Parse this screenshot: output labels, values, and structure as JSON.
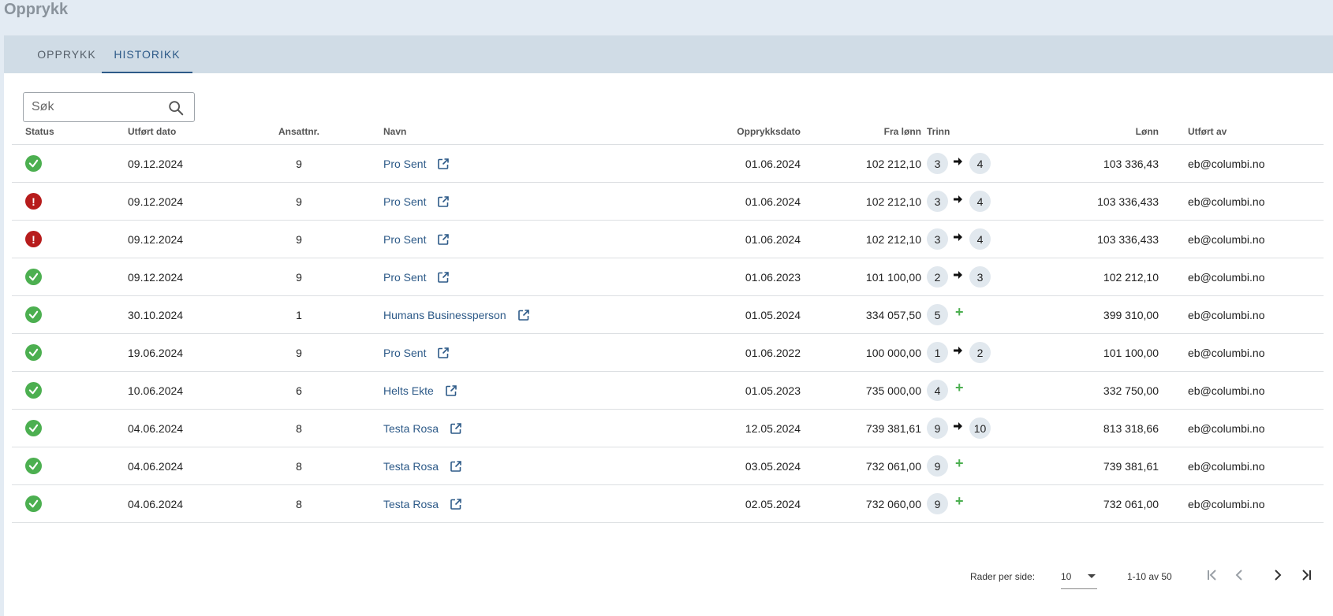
{
  "page": {
    "title": "Opprykk"
  },
  "tabs": [
    {
      "label": "OPPRYKK",
      "active": false
    },
    {
      "label": "HISTORIKK",
      "active": true
    }
  ],
  "search": {
    "placeholder": "Søk",
    "value": ""
  },
  "table": {
    "headers": {
      "status": "Status",
      "utfort_dato": "Utført dato",
      "ansattnr": "Ansattnr.",
      "navn": "Navn",
      "opprykksdato": "Opprykksdato",
      "fra_lonn": "Fra lønn",
      "trinn": "Trinn",
      "lonn": "Lønn",
      "utfort_av": "Utført av"
    },
    "rows": [
      {
        "status": "success",
        "utfort_dato": "09.12.2024",
        "ansattnr": "9",
        "navn": "Pro Sent",
        "opprykksdato": "01.06.2024",
        "fra_lonn": "102 212,10",
        "trinn_fra": "3",
        "trinn_til": "4",
        "lonn": "103 336,43",
        "utfort_av": "eb@columbi.no"
      },
      {
        "status": "error",
        "utfort_dato": "09.12.2024",
        "ansattnr": "9",
        "navn": "Pro Sent",
        "opprykksdato": "01.06.2024",
        "fra_lonn": "102 212,10",
        "trinn_fra": "3",
        "trinn_til": "4",
        "lonn": "103 336,433",
        "utfort_av": "eb@columbi.no"
      },
      {
        "status": "error",
        "utfort_dato": "09.12.2024",
        "ansattnr": "9",
        "navn": "Pro Sent",
        "opprykksdato": "01.06.2024",
        "fra_lonn": "102 212,10",
        "trinn_fra": "3",
        "trinn_til": "4",
        "lonn": "103 336,433",
        "utfort_av": "eb@columbi.no"
      },
      {
        "status": "success",
        "utfort_dato": "09.12.2024",
        "ansattnr": "9",
        "navn": "Pro Sent",
        "opprykksdato": "01.06.2023",
        "fra_lonn": "101 100,00",
        "trinn_fra": "2",
        "trinn_til": "3",
        "lonn": "102 212,10",
        "utfort_av": "eb@columbi.no"
      },
      {
        "status": "success",
        "utfort_dato": "30.10.2024",
        "ansattnr": "1",
        "navn": "Humans Businessperson",
        "opprykksdato": "01.05.2024",
        "fra_lonn": "334 057,50",
        "trinn_fra": "5",
        "trinn_til": "+",
        "lonn": "399 310,00",
        "utfort_av": "eb@columbi.no"
      },
      {
        "status": "success",
        "utfort_dato": "19.06.2024",
        "ansattnr": "9",
        "navn": "Pro Sent",
        "opprykksdato": "01.06.2022",
        "fra_lonn": "100 000,00",
        "trinn_fra": "1",
        "trinn_til": "2",
        "lonn": "101 100,00",
        "utfort_av": "eb@columbi.no"
      },
      {
        "status": "success",
        "utfort_dato": "10.06.2024",
        "ansattnr": "6",
        "navn": "Helts Ekte",
        "opprykksdato": "01.05.2023",
        "fra_lonn": "735 000,00",
        "trinn_fra": "4",
        "trinn_til": "+",
        "lonn": "332 750,00",
        "utfort_av": "eb@columbi.no"
      },
      {
        "status": "success",
        "utfort_dato": "04.06.2024",
        "ansattnr": "8",
        "navn": "Testa Rosa",
        "opprykksdato": "12.05.2024",
        "fra_lonn": "739 381,61",
        "trinn_fra": "9",
        "trinn_til": "10",
        "lonn": "813 318,66",
        "utfort_av": "eb@columbi.no"
      },
      {
        "status": "success",
        "utfort_dato": "04.06.2024",
        "ansattnr": "8",
        "navn": "Testa Rosa",
        "opprykksdato": "03.05.2024",
        "fra_lonn": "732 061,00",
        "trinn_fra": "9",
        "trinn_til": "+",
        "lonn": "739 381,61",
        "utfort_av": "eb@columbi.no"
      },
      {
        "status": "success",
        "utfort_dato": "04.06.2024",
        "ansattnr": "8",
        "navn": "Testa Rosa",
        "opprykksdato": "02.05.2024",
        "fra_lonn": "732 060,00",
        "trinn_fra": "9",
        "trinn_til": "+",
        "lonn": "732 061,00",
        "utfort_av": "eb@columbi.no"
      }
    ]
  },
  "pagination": {
    "rows_per_page_label": "Rader per side:",
    "rows_per_page_value": "10",
    "range": "1-10 av 50"
  },
  "icons": {
    "search": "search-icon",
    "status_success": "check-circle-icon",
    "status_error": "error-circle-icon",
    "external_link": "external-link-icon",
    "arrow": "arrow-right-icon",
    "plus": "plus-icon"
  },
  "colors": {
    "accent": "#2d5a88",
    "success": "#4caf50",
    "error": "#b71c1c",
    "tabbar": "#d0dce6",
    "chip": "#e1e8ee"
  }
}
